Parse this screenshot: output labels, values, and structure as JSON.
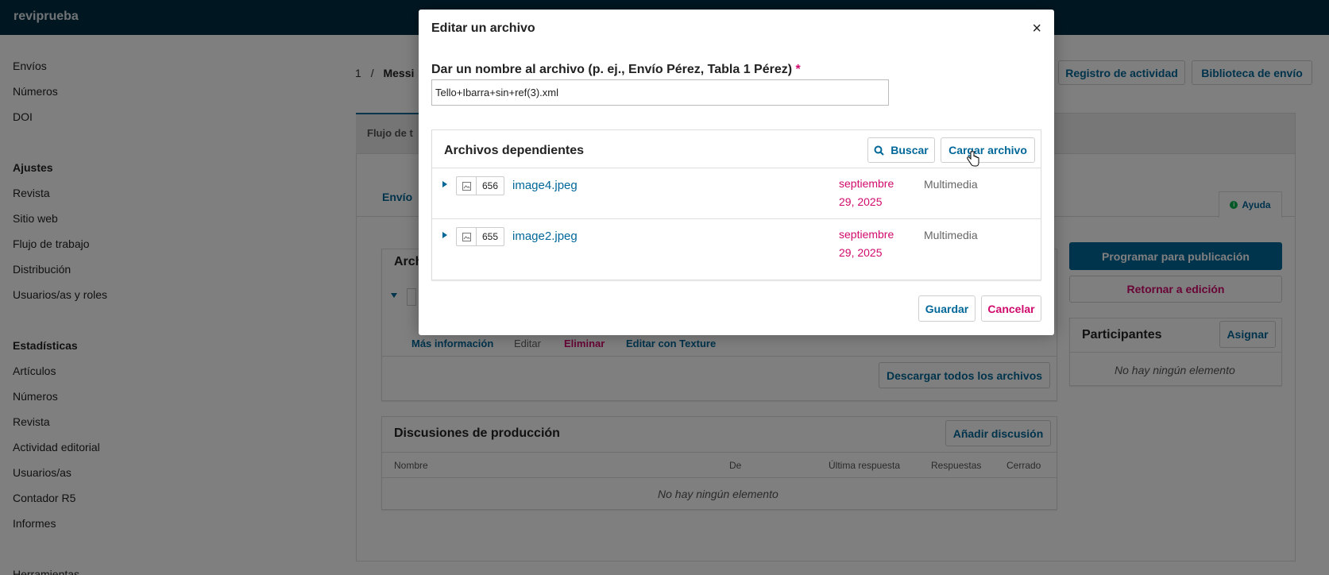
{
  "app": {
    "site_name": "reviprueba"
  },
  "sidebar": {
    "items": [
      {
        "label": "Envíos"
      },
      {
        "label": "Números"
      },
      {
        "label": "DOI"
      },
      {
        "label": "Ajustes"
      },
      {
        "label": "Revista"
      },
      {
        "label": "Sitio web"
      },
      {
        "label": "Flujo de trabajo"
      },
      {
        "label": "Distribución"
      },
      {
        "label": "Usuarios/as y roles"
      },
      {
        "label": "Estadísticas"
      },
      {
        "label": "Artículos"
      },
      {
        "label": "Números"
      },
      {
        "label": "Revista"
      },
      {
        "label": "Actividad editorial"
      },
      {
        "label": "Usuarios/as"
      },
      {
        "label": "Contador R5"
      },
      {
        "label": "Informes"
      },
      {
        "label": "Herramientas"
      }
    ]
  },
  "header": {
    "breadcrumb_id": "1",
    "breadcrumb_sep": "/",
    "breadcrumb_title": "Messi",
    "activity_button": "Registro de actividad",
    "library_button": "Biblioteca de envío"
  },
  "workflow": {
    "tab_label": "Flujo de t",
    "subtab_label": "Envío",
    "help_label": "Ayuda",
    "files_panel_title": "Arch",
    "file_actions": {
      "more_info": "Más información",
      "edit": "Editar",
      "delete": "Eliminar",
      "texture": "Editar con Texture"
    },
    "download_all": "Descargar todos los archivos",
    "schedule_button": "Programar para publicación",
    "return_button": "Retornar a edición",
    "participants_title": "Participantes",
    "assign_button": "Asignar",
    "no_items": "No hay ningún elemento",
    "discussions": {
      "title": "Discusiones de producción",
      "add_button": "Añadir discusión",
      "columns": [
        "Nombre",
        "De",
        "Última respuesta",
        "Respuestas",
        "Cerrado"
      ],
      "empty": "No hay ningún elemento"
    }
  },
  "modal": {
    "title": "Editar un archivo",
    "close_symbol": "×",
    "name_label": "Dar un nombre al archivo (p. ej., Envío Pérez, Tabla 1 Pérez)",
    "required_mark": "*",
    "name_value": "Tello+Ibarra+sin+ref(3).xml",
    "dependent": {
      "title": "Archivos dependientes",
      "search_button": "Buscar",
      "upload_button": "Cargar archivo",
      "files": [
        {
          "id": "656",
          "name": "image4.jpeg",
          "date_line1": "septiembre",
          "date_line2": "29, 2025",
          "type": "Multimedia"
        },
        {
          "id": "655",
          "name": "image2.jpeg",
          "date_line1": "septiembre",
          "date_line2": "29, 2025",
          "type": "Multimedia"
        }
      ]
    },
    "save_button": "Guardar",
    "cancel_button": "Cancelar"
  },
  "colors": {
    "primary": "#006798",
    "danger": "#d00a6c",
    "topbar": "#002f45"
  }
}
